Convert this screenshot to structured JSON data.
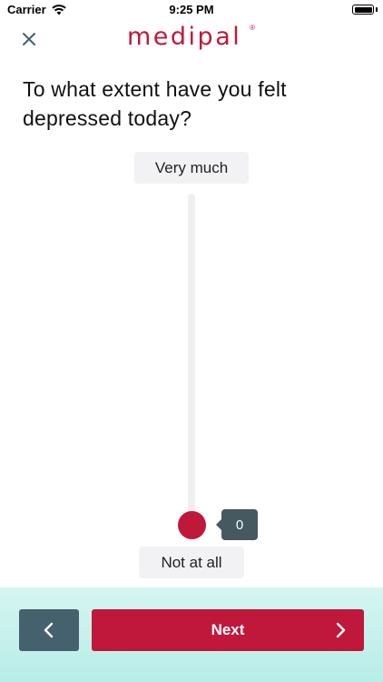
{
  "status_bar": {
    "carrier": "Carrier",
    "time": "9:25 PM",
    "icons": [
      "wifi-icon",
      "battery-icon"
    ]
  },
  "header": {
    "close_icon": "close-icon",
    "logo_text": "medipal",
    "logo_mark": "®"
  },
  "question": {
    "text": "To what extent have you felt depressed today?"
  },
  "slider": {
    "top_label": "Very much",
    "bottom_label": "Not at all",
    "value": "0",
    "value_fraction": 0
  },
  "navigation": {
    "back_icon": "chevron-left-icon",
    "next_label": "Next",
    "next_icon": "chevron-right-icon"
  },
  "colors": {
    "brand": "#c0183a",
    "slate": "#45616d",
    "bubble": "#465860",
    "footer": "#c9f1ec"
  }
}
